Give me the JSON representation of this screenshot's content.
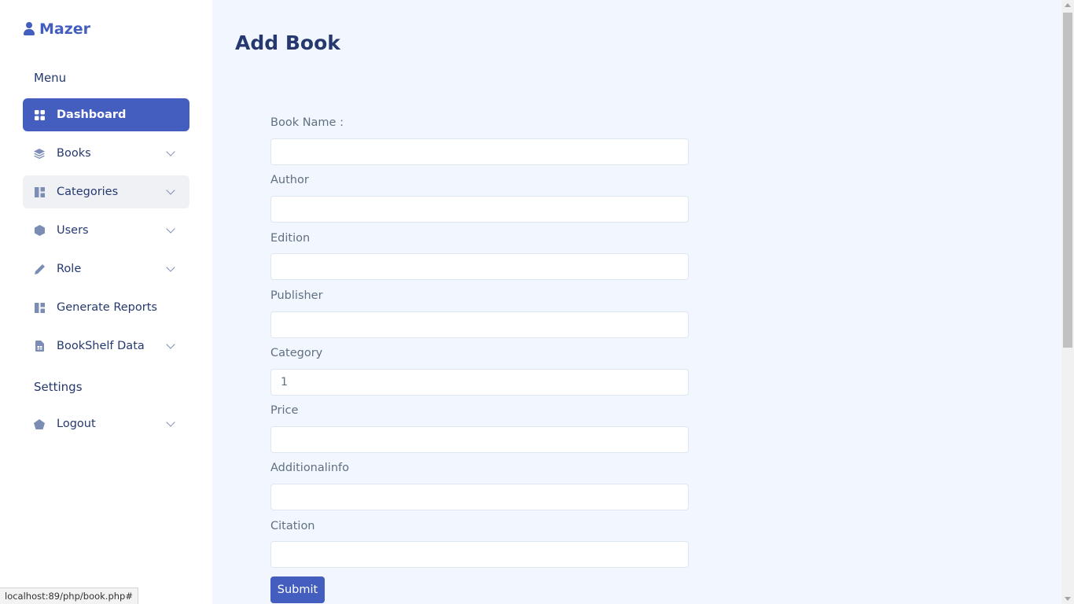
{
  "app": {
    "name": "Mazer"
  },
  "sidebar": {
    "menu_title": "Menu",
    "settings_title": "Settings",
    "items": [
      {
        "label": "Dashboard",
        "icon": "grid-icon",
        "active": true,
        "has_submenu": false
      },
      {
        "label": "Books",
        "icon": "stack-icon",
        "active": false,
        "has_submenu": true
      },
      {
        "label": "Categories",
        "icon": "collection-icon",
        "active": false,
        "has_submenu": true
      },
      {
        "label": "Users",
        "icon": "hexagon-icon",
        "active": false,
        "has_submenu": true
      },
      {
        "label": "Role",
        "icon": "pen-icon",
        "active": false,
        "has_submenu": true
      },
      {
        "label": "Generate Reports",
        "icon": "collection-icon",
        "active": false,
        "has_submenu": false
      },
      {
        "label": "BookShelf Data",
        "icon": "file-spreadsheet-icon",
        "active": false,
        "has_submenu": true
      }
    ],
    "settings_items": [
      {
        "label": "Logout",
        "icon": "pentagon-icon",
        "active": false,
        "has_submenu": true
      }
    ]
  },
  "main": {
    "title": "Add Book",
    "form": {
      "fields": [
        {
          "label": "Book Name :",
          "value": ""
        },
        {
          "label": "Author",
          "value": ""
        },
        {
          "label": "Edition",
          "value": ""
        },
        {
          "label": "Publisher",
          "value": ""
        },
        {
          "label": "Category",
          "value": "1"
        },
        {
          "label": "Price",
          "value": ""
        },
        {
          "label": "Additionalinfo",
          "value": ""
        },
        {
          "label": "Citation",
          "value": ""
        }
      ],
      "submit_label": "Submit"
    }
  },
  "status_bar": {
    "url": "localhost:89/php/book.php#"
  },
  "colors": {
    "primary": "#435ebe",
    "text_dark": "#25396f",
    "label_grey": "#607080",
    "background": "#f2f7ff",
    "icon_grey": "#7c8db5"
  }
}
